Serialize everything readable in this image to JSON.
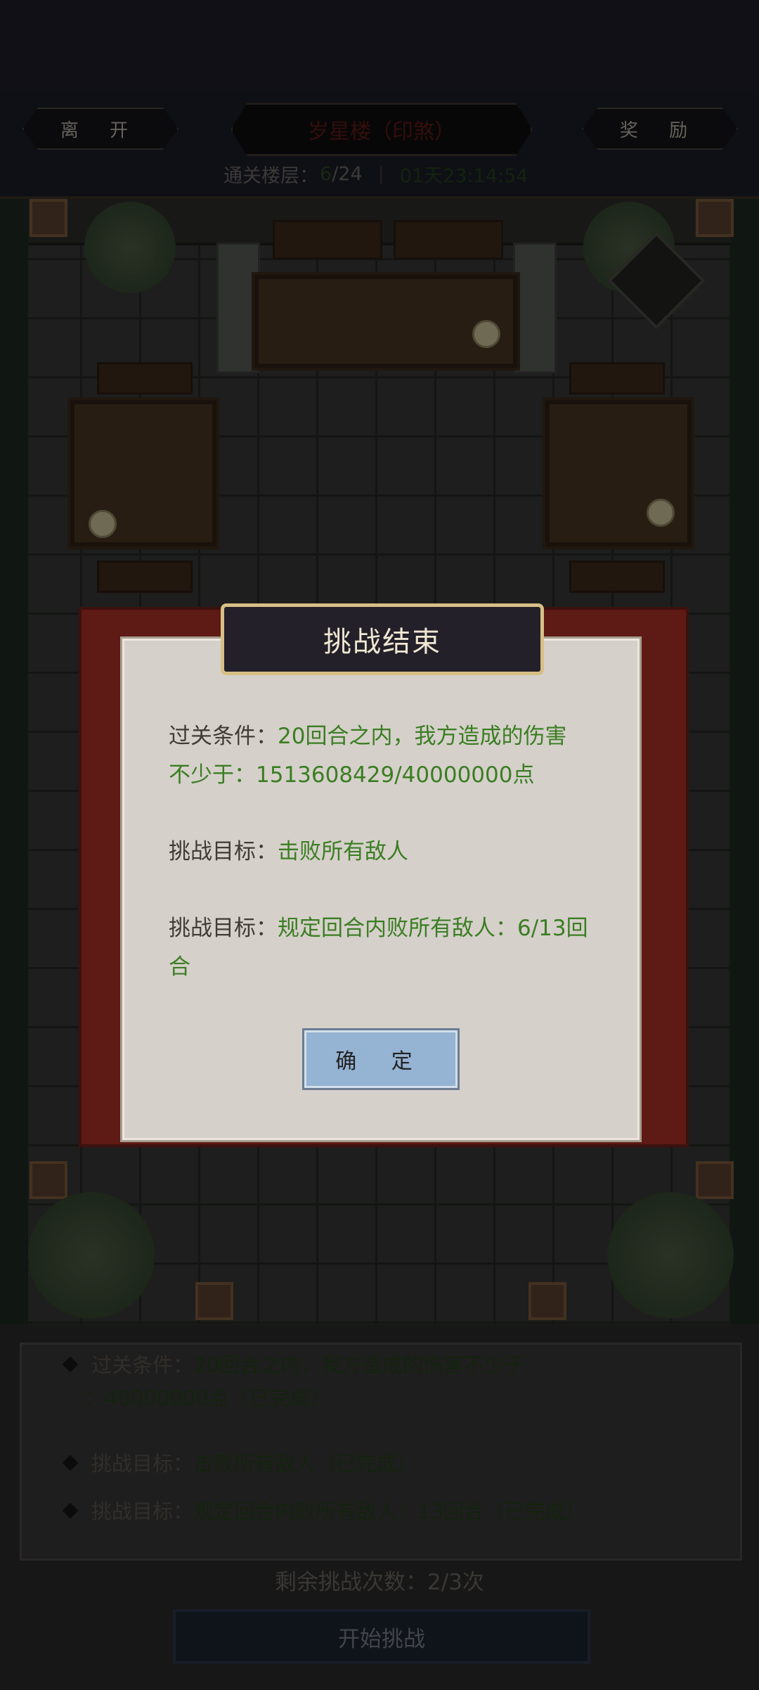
{
  "header": {
    "leave_label": "离 开",
    "reward_label": "奖 励",
    "title": "岁星楼（印煞）",
    "floor_label": "通关楼层：",
    "floor_current": "6",
    "floor_total": "/24",
    "timer": "01天23:14:54"
  },
  "dialog": {
    "title": "挑战结束",
    "condition_label": "过关条件：",
    "condition_text_1": "20回合之内，我方造成的伤害",
    "condition_text_2": "不少于：1513608429/40000000点",
    "goal1_label": "挑战目标：",
    "goal1_text": "击败所有敌人",
    "goal2_label": "挑战目标：",
    "goal2_text_1": "规定回合内败所有敌人：6/13回",
    "goal2_text_2": "合",
    "confirm_label": "确 定"
  },
  "bottom": {
    "condition_label": "过关条件：",
    "condition_text_1": "20回合之内，我方造成的伤害不少于",
    "condition_text_2": "：40000000点（已完成）",
    "goal1_label": "挑战目标：",
    "goal1_text": "击败所有敌人（已完成）",
    "goal2_label": "挑战目标：",
    "goal2_text": "规定回合内败所有敌人：13回合（已完成）",
    "remaining": "剩余挑战次数：2/3次",
    "start_label": "开始挑战"
  },
  "colors": {
    "accent_green": "#3a7e22",
    "dialog_border": "#d7bf86",
    "confirm_button": "#95b3d2"
  }
}
